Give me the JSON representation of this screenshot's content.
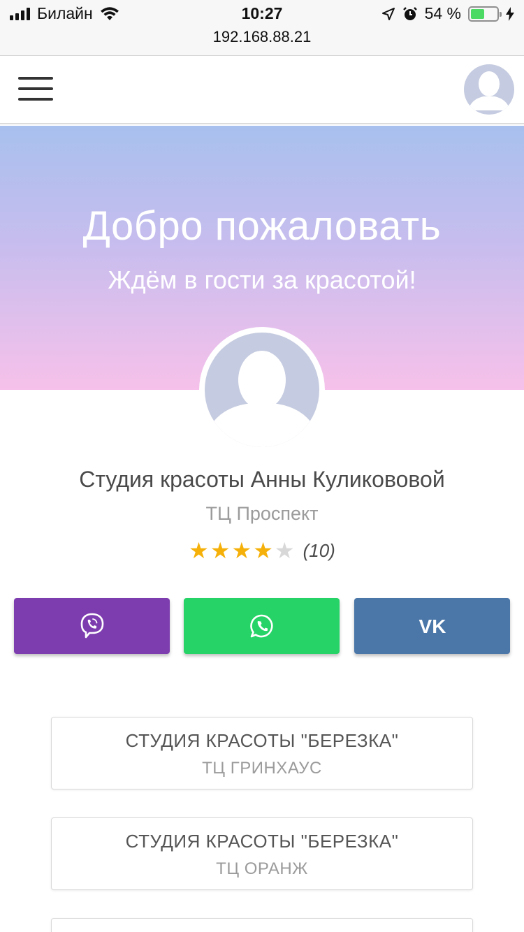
{
  "status_bar": {
    "carrier": "Билайн",
    "time": "10:27",
    "url": "192.168.88.21",
    "battery": "54 %",
    "battery_level": 0.54
  },
  "hero": {
    "title": "Добро пожаловать",
    "subtitle": "Ждём в гости за красотой!"
  },
  "profile": {
    "name": "Студия красоты Анны Куликововой",
    "location": "ТЦ Проспект",
    "rating_stars": 4,
    "rating_max": 5,
    "rating_count": "(10)"
  },
  "social": {
    "viber_icon": "viber-icon",
    "whatsapp_icon": "whatsapp-icon",
    "vk_icon": "vk-icon",
    "vk_label": "VK"
  },
  "branches": [
    {
      "name": "СТУДИЯ КРАСОТЫ \"БЕРЕЗКА\"",
      "location": "ТЦ ГРИНХАУС"
    },
    {
      "name": "СТУДИЯ КРАСОТЫ \"БЕРЕЗКА\"",
      "location": "ТЦ ОРАНЖ"
    },
    {
      "name": "",
      "location": ""
    }
  ],
  "colors": {
    "viber": "#7d3daf",
    "whatsapp": "#25d366",
    "vk": "#4a76a8",
    "star": "#f5b10a"
  }
}
